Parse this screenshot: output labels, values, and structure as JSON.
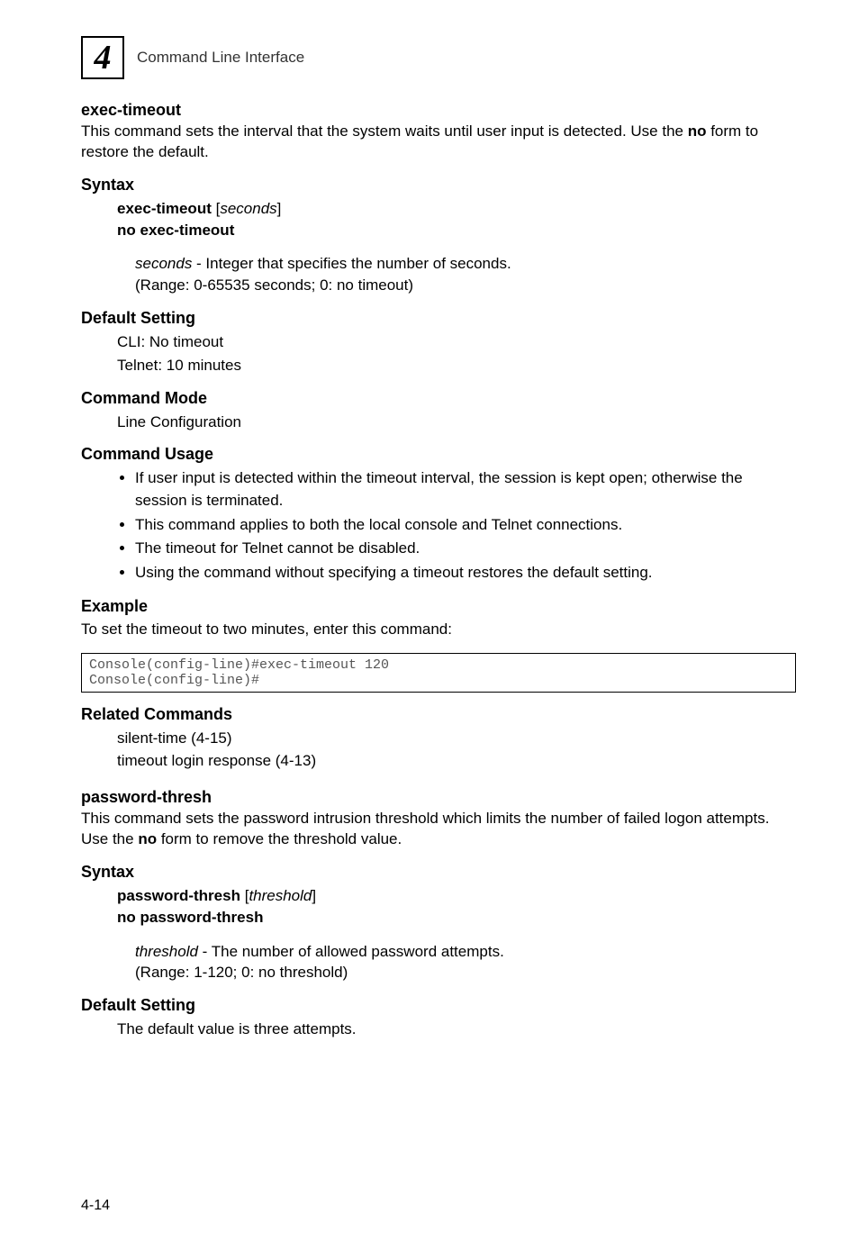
{
  "header": {
    "chapter": "4",
    "title": "Command Line Interface"
  },
  "section1": {
    "heading": "exec-timeout",
    "intro_part1": "This command sets the interval that the system waits until user input is detected. Use the ",
    "intro_bold": "no",
    "intro_part2": " form to restore the default.",
    "syntax_heading": "Syntax",
    "syntax_cmd1": "exec-timeout",
    "syntax_arg1": "seconds",
    "syntax_cmd2": "no exec-timeout",
    "syntax_desc_arg": "seconds",
    "syntax_desc_rest": " - Integer that specifies the number of seconds.",
    "syntax_desc_range": "(Range: 0-65535 seconds; 0: no timeout)",
    "default_heading": "Default Setting",
    "default_line1": "CLI: No timeout",
    "default_line2": "Telnet: 10 minutes",
    "mode_heading": "Command Mode",
    "mode_line": "Line Configuration",
    "usage_heading": "Command Usage",
    "usage_bullets": [
      "If user input is detected within the timeout interval, the session is kept open; otherwise the session is terminated.",
      "This command applies to both the local console and Telnet connections.",
      "The timeout for Telnet cannot be disabled.",
      "Using the command without specifying a timeout restores the default setting."
    ],
    "example_heading": "Example",
    "example_text": "To set the timeout to two minutes, enter this command:",
    "example_code": "Console(config-line)#exec-timeout 120\nConsole(config-line)#",
    "related_heading": "Related Commands",
    "related_line1": "silent-time (4-15)",
    "related_line2": "timeout login response (4-13)"
  },
  "section2": {
    "heading": "password-thresh",
    "intro_part1": "This command sets the password intrusion threshold which limits the number of failed logon attempts. Use the ",
    "intro_bold": "no",
    "intro_part2": " form to remove the threshold value.",
    "syntax_heading": "Syntax",
    "syntax_cmd1": "password-thresh",
    "syntax_arg1": "threshold",
    "syntax_cmd2": "no password-thresh",
    "syntax_desc_arg": "threshold",
    "syntax_desc_rest": " - The number of allowed password attempts.",
    "syntax_desc_range": "(Range: 1-120; 0: no threshold)",
    "default_heading": "Default Setting",
    "default_line1": "The default value is three attempts."
  },
  "page_number": "4-14"
}
